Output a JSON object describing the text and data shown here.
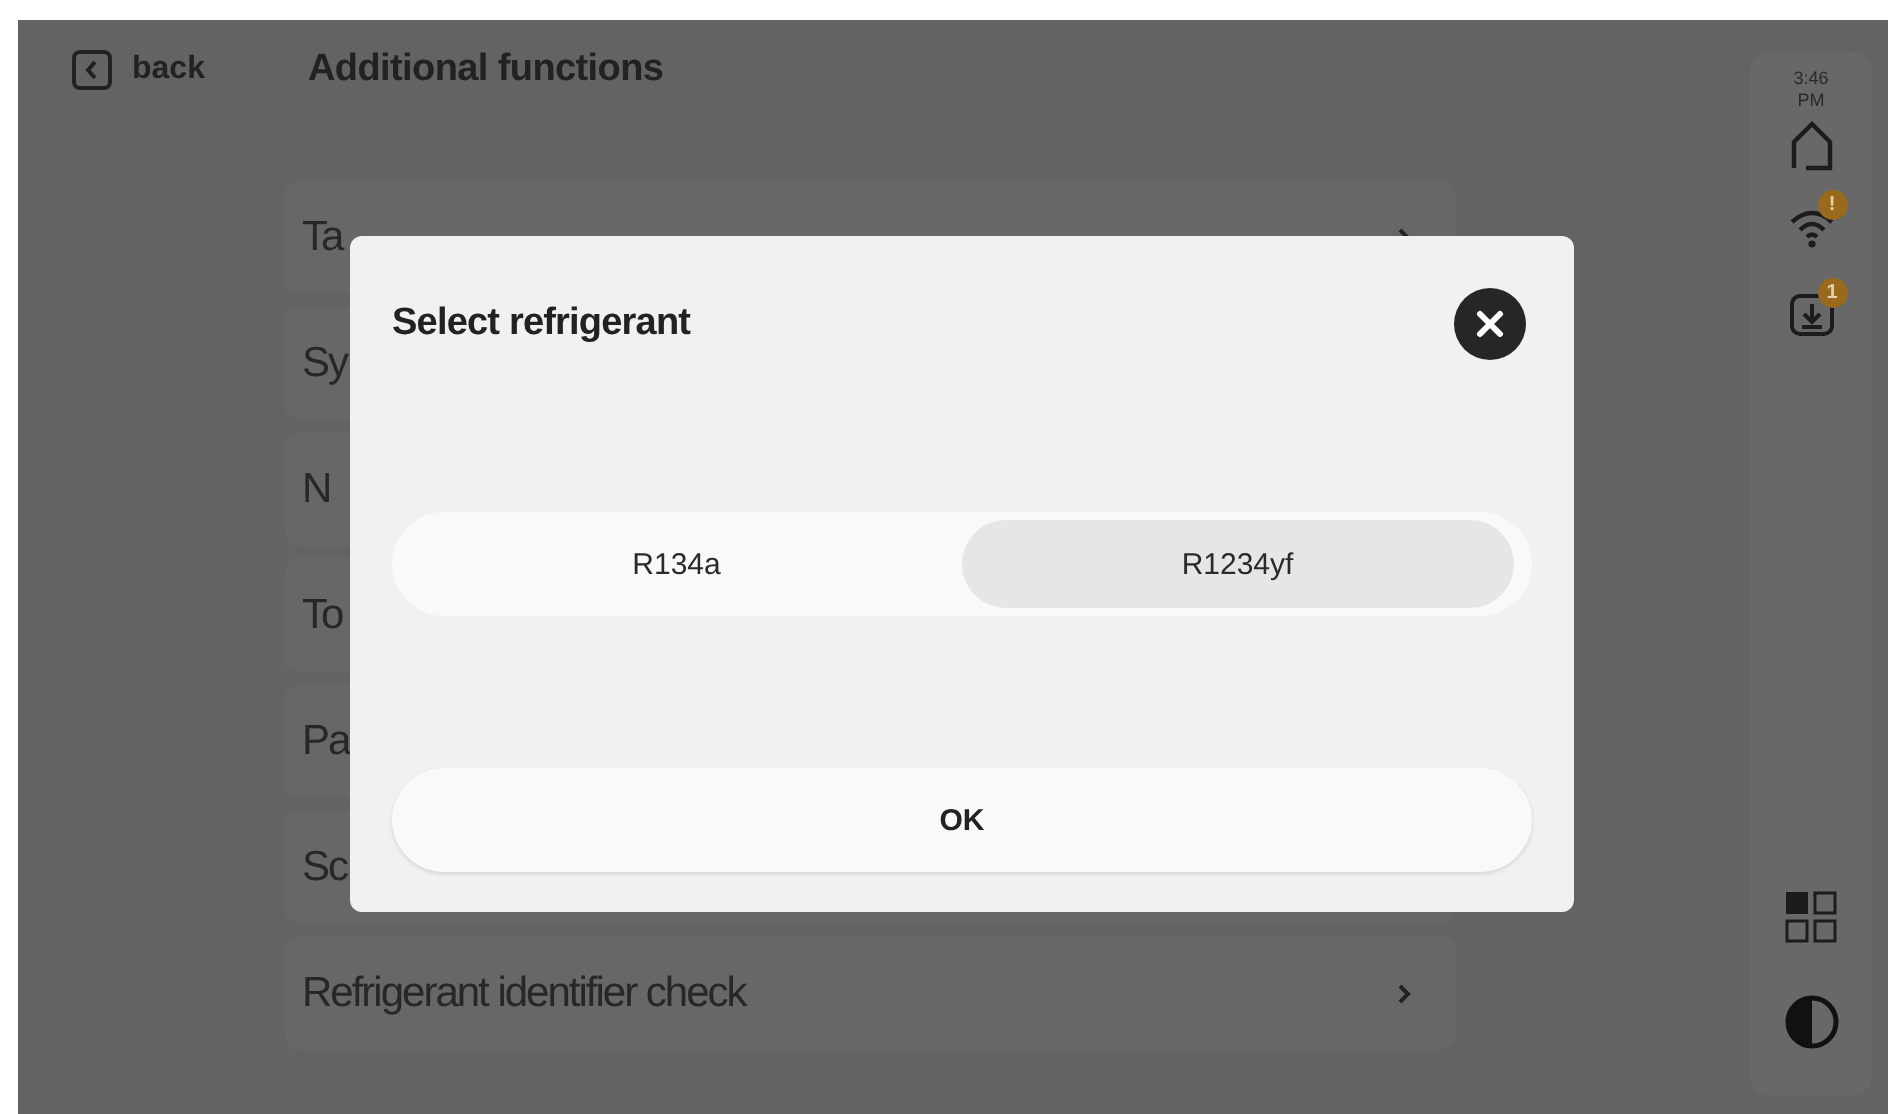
{
  "header": {
    "back_label": "back",
    "title": "Additional functions"
  },
  "menu_items": [
    {
      "label": "Ta",
      "chevron": true
    },
    {
      "label": "Sy",
      "chevron": false
    },
    {
      "label": "N",
      "chevron": false
    },
    {
      "label": "To",
      "chevron": false
    },
    {
      "label": "Pa",
      "chevron": false
    },
    {
      "label": "Sc",
      "chevron": false
    },
    {
      "label": "Refrigerant identifier check",
      "chevron": true
    }
  ],
  "sidebar": {
    "time": "3:46",
    "period": "PM",
    "wifi_badge": "!",
    "download_badge": "1"
  },
  "dialog": {
    "title": "Select refrigerant",
    "options": [
      {
        "label": "R134a",
        "selected": false
      },
      {
        "label": "R1234yf",
        "selected": true
      }
    ],
    "ok_label": "OK"
  }
}
